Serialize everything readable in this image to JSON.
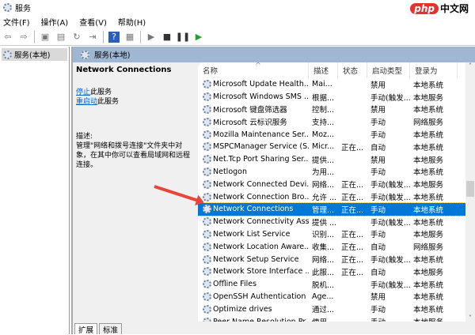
{
  "window": {
    "title": "服务"
  },
  "watermark": {
    "php": "php",
    "text": "中文网"
  },
  "menu": [
    "文件(F)",
    "操作(A)",
    "查看(V)",
    "帮助(H)"
  ],
  "toolbar": {
    "icons": [
      "back-icon",
      "forward-icon",
      "console-tree-icon",
      "export-icon",
      "refresh-icon",
      "export-list-icon",
      "help-icon",
      "properties-icon",
      "start-icon",
      "stop-icon",
      "pause-icon",
      "restart-icon"
    ],
    "glyphs": [
      "⇦",
      "⇨",
      "▣",
      "▤",
      "↻",
      "⇥",
      "?",
      "▦",
      "▶",
      "■",
      "❚❚",
      "▶"
    ]
  },
  "tree": {
    "item": "服务(本地)"
  },
  "main": {
    "header": "服务(本地)",
    "detail": {
      "title": "Network Connections",
      "stop_link": "停止",
      "stop_suffix": "此服务",
      "restart_link": "重启动",
      "restart_suffix": "此服务",
      "desc_label": "描述:",
      "desc_text": "管理\"网络和拨号连接\"文件夹中对象，在其中你可以查看局域网和远程连接。"
    },
    "columns": [
      "名称",
      "描述",
      "状态",
      "启动类型",
      "登录为"
    ],
    "rows": [
      [
        "Microsoft Update Health...",
        "Mai...",
        "",
        "禁用",
        "本地系统"
      ],
      [
        "Microsoft Windows SMS ...",
        "根据...",
        "",
        "手动(触发...",
        "本地服务"
      ],
      [
        "Microsoft 键盘筛选器",
        "控制...",
        "",
        "禁用",
        "本地系统"
      ],
      [
        "Microsoft 云标识服务",
        "支持...",
        "",
        "手动",
        "网络服务"
      ],
      [
        "Mozilla Maintenance Ser...",
        "Moz...",
        "",
        "手动",
        "本地系统"
      ],
      [
        "MSPCManager Service (S...",
        "Micr...",
        "正在...",
        "自动",
        "本地系统"
      ],
      [
        "Net.Tcp Port Sharing Ser...",
        "提供...",
        "",
        "禁用",
        "本地服务"
      ],
      [
        "Netlogon",
        "为用...",
        "",
        "手动",
        "本地系统"
      ],
      [
        "Network Connected Devi...",
        "网络...",
        "正在...",
        "手动(触发...",
        "本地服务"
      ],
      [
        "Network Connection Bro...",
        "允许 ...",
        "正在...",
        "手动(触发...",
        "本地系统"
      ],
      [
        "Network Connections",
        "管理...",
        "正在...",
        "手动",
        "本地系统"
      ],
      [
        "Network Connectivity Ass...",
        "提供 ...",
        "",
        "手动(触发...",
        "本地系统"
      ],
      [
        "Network List Service",
        "识别...",
        "正在...",
        "手动",
        "本地服务"
      ],
      [
        "Network Location Aware...",
        "收集...",
        "正在...",
        "自动",
        "网络服务"
      ],
      [
        "Network Setup Service",
        "网络...",
        "正在...",
        "手动(触发...",
        "本地系统"
      ],
      [
        "Network Store Interface ...",
        "此服...",
        "正在...",
        "自动",
        "本地服务"
      ],
      [
        "Offline Files",
        "脱机...",
        "",
        "手动(触发...",
        "本地系统"
      ],
      [
        "OpenSSH Authentication ...",
        "Age...",
        "",
        "禁用",
        "本地系统"
      ],
      [
        "Optimize drives",
        "通过...",
        "",
        "手动",
        "本地系统"
      ],
      [
        "Peer Name Resolution Pr...",
        "使用...",
        "",
        "手动",
        "本地服务"
      ]
    ],
    "selected_index": 10,
    "tabs": [
      "扩展",
      "标准"
    ]
  }
}
